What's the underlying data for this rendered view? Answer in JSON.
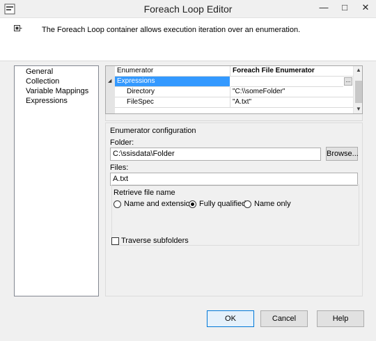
{
  "window": {
    "title": "Foreach Loop Editor",
    "minimize_glyph": "—",
    "restore_glyph": "□",
    "close_glyph": "✕",
    "icons": [
      "app-icon",
      "minimize-icon",
      "restore-icon",
      "close-icon"
    ]
  },
  "header": {
    "description": "The Foreach Loop container allows execution iteration over an enumeration.",
    "icon": "loop-icon"
  },
  "nav": {
    "items": [
      {
        "label": "General"
      },
      {
        "label": "Collection"
      },
      {
        "label": "Variable Mappings"
      },
      {
        "label": "Expressions"
      }
    ]
  },
  "grid": {
    "rows": [
      {
        "property": "Enumerator",
        "value": "Foreach File Enumerator"
      },
      {
        "property": "Expressions",
        "value": ""
      },
      {
        "property": "Directory",
        "value": "\"C:\\\\someFolder\""
      },
      {
        "property": "FileSpec",
        "value": "\"A.txt\""
      }
    ],
    "ellipsis_label": "...",
    "expand_glyph": "◢",
    "scroll_up_glyph": "▲",
    "scroll_down_glyph": "▼",
    "selected_color": "#3399ff"
  },
  "config": {
    "group_label": "Enumerator configuration",
    "folder_label": "Folder:",
    "folder_value": "C:\\ssisdata\\Folder",
    "browse_label": "Browse...",
    "files_label": "Files:",
    "files_value": "A.txt",
    "retrieve_label": "Retrieve file name",
    "retrieve_options": [
      {
        "label": "Name and extension",
        "selected": false
      },
      {
        "label": "Fully qualified",
        "selected": true
      },
      {
        "label": "Name only",
        "selected": false
      }
    ],
    "traverse_label": "Traverse subfolders",
    "traverse_checked": false
  },
  "footer": {
    "ok_label": "OK",
    "cancel_label": "Cancel",
    "help_label": "Help"
  }
}
